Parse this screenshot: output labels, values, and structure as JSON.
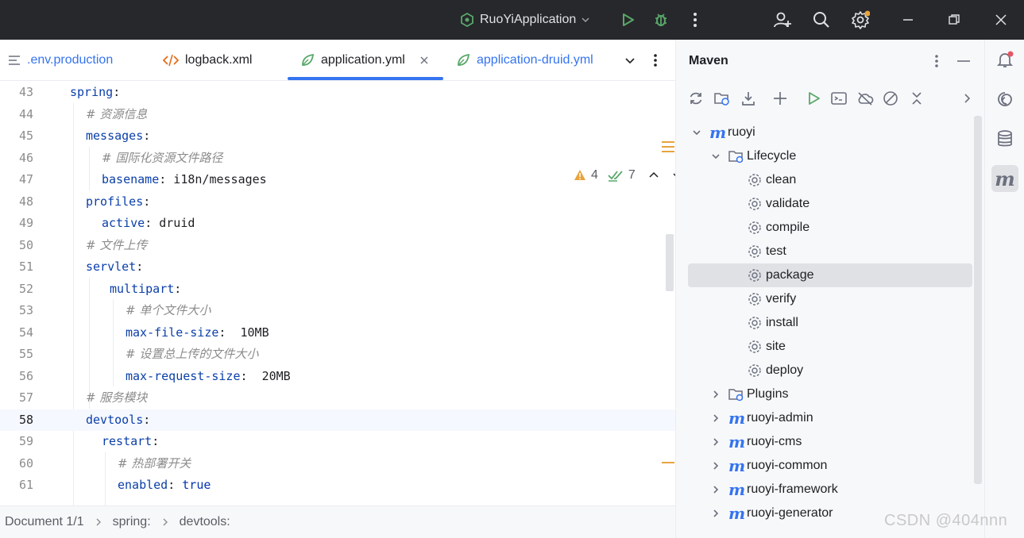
{
  "titlebar": {
    "run_config": "RuoYiApplication"
  },
  "tabs": [
    {
      "label": ".env.production",
      "icon": "text-file-icon"
    },
    {
      "label": "logback.xml",
      "icon": "xml-icon"
    },
    {
      "label": "application.yml",
      "icon": "spring-icon",
      "active": true
    },
    {
      "label": "application-druid.yml",
      "icon": "spring-icon"
    }
  ],
  "inspections": {
    "warnings": "4",
    "ok": "7"
  },
  "editor": {
    "lines": [
      {
        "n": "43",
        "key": "spring",
        "sep": ":",
        "val": ""
      },
      {
        "n": "44",
        "comment": "# 资源信息"
      },
      {
        "n": "45",
        "key": "messages",
        "sep": ":",
        "val": ""
      },
      {
        "n": "46",
        "comment": "# 国际化资源文件路径"
      },
      {
        "n": "47",
        "key": "basename",
        "sep": ":",
        "val": " i18n/messages"
      },
      {
        "n": "48",
        "key": "profiles",
        "sep": ":",
        "val": ""
      },
      {
        "n": "49",
        "key": "active",
        "sep": ":",
        "val": " druid"
      },
      {
        "n": "50",
        "comment": "# 文件上传"
      },
      {
        "n": "51",
        "key": "servlet",
        "sep": ":",
        "val": ""
      },
      {
        "n": "52",
        "key": "multipart",
        "sep": ":",
        "val": ""
      },
      {
        "n": "53",
        "comment": "# 单个文件大小"
      },
      {
        "n": "54",
        "key": "max-file-size",
        "sep": ":",
        "val": "  10MB"
      },
      {
        "n": "55",
        "comment": "# 设置总上传的文件大小"
      },
      {
        "n": "56",
        "key": "max-request-size",
        "sep": ":",
        "val": "  20MB"
      },
      {
        "n": "57",
        "comment": "# 服务模块"
      },
      {
        "n": "58",
        "key": "devtools",
        "sep": ":",
        "val": ""
      },
      {
        "n": "59",
        "key": "restart",
        "sep": ":",
        "val": ""
      },
      {
        "n": "60",
        "comment": "# 热部署开关"
      },
      {
        "n": "61",
        "key": "enabled",
        "sep": ":",
        "val": " true"
      }
    ]
  },
  "statusbar": {
    "document": "Document 1/1",
    "crumb1": "spring:",
    "crumb2": "devtools:"
  },
  "maven": {
    "title": "Maven",
    "tree": [
      {
        "label": "ruoyi",
        "type": "project"
      },
      {
        "label": "Lifecycle",
        "type": "folder"
      },
      {
        "label": "clean",
        "type": "goal"
      },
      {
        "label": "validate",
        "type": "goal"
      },
      {
        "label": "compile",
        "type": "goal"
      },
      {
        "label": "test",
        "type": "goal"
      },
      {
        "label": "package",
        "type": "goal",
        "selected": true
      },
      {
        "label": "verify",
        "type": "goal"
      },
      {
        "label": "install",
        "type": "goal"
      },
      {
        "label": "site",
        "type": "goal"
      },
      {
        "label": "deploy",
        "type": "goal"
      },
      {
        "label": "Plugins",
        "type": "folder"
      },
      {
        "label": "ruoyi-admin",
        "type": "module"
      },
      {
        "label": "ruoyi-cms",
        "type": "module"
      },
      {
        "label": "ruoyi-common",
        "type": "module"
      },
      {
        "label": "ruoyi-framework",
        "type": "module"
      },
      {
        "label": "ruoyi-generator",
        "type": "module"
      }
    ]
  },
  "watermark": "CSDN @404nnn",
  "colors": {
    "accent": "#3574f0",
    "titlebar": "#27282c",
    "run_green": "#59a869",
    "warning": "#e8a33d"
  }
}
